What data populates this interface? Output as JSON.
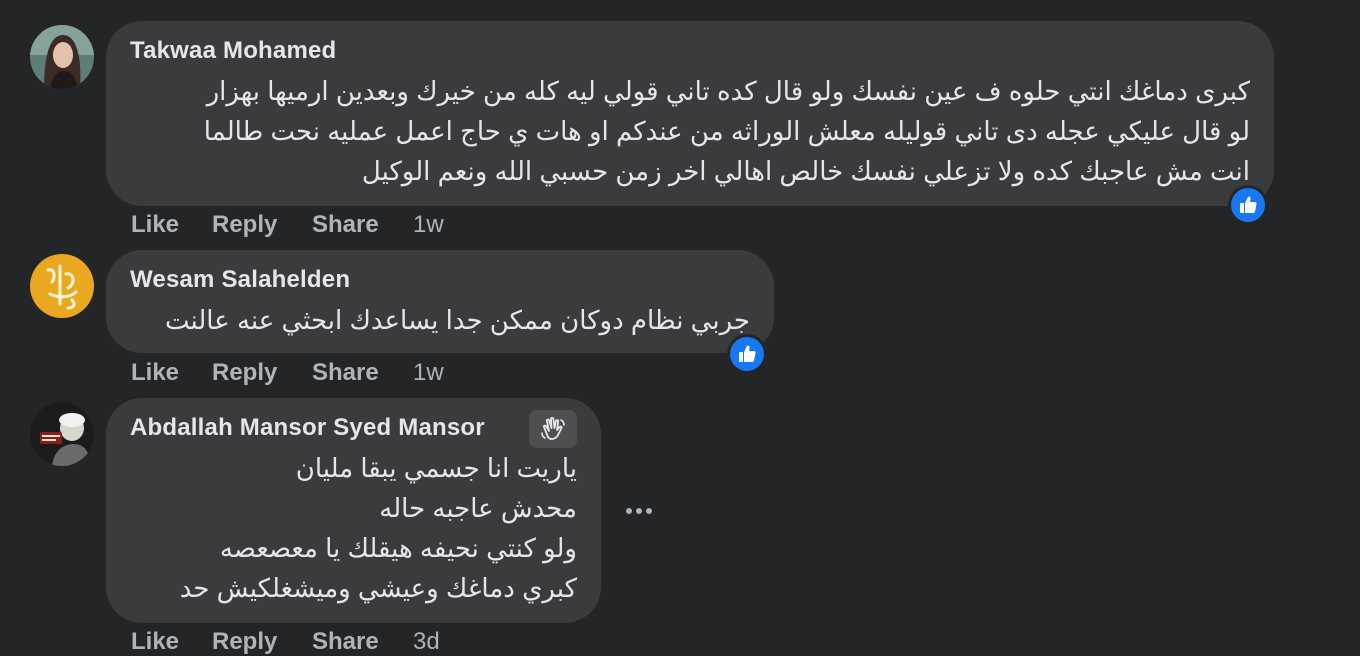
{
  "comments": [
    {
      "author": "Takwaa Mohamed",
      "lines": [
        "كبرى دماغك انتي حلوه ف عين نفسك ولو قال كده تاني قولي ليه كله من خيرك وبعدين ارميها بهزار",
        "لو قال عليكي عجله دى تاني قوليله معلش الوراثه من عندكم او هات ي حاج اعمل عمليه نحت طالما",
        "انت مش عاجبك كده ولا تزعلي نفسك خالص اهالي اخر زمن حسبي الله ونعم الوكيل"
      ],
      "actions": {
        "like": "Like",
        "reply": "Reply",
        "share": "Share",
        "time": "1w"
      },
      "reaction_icon": "like-thumb-icon"
    },
    {
      "author": "Wesam Salahelden",
      "lines": [
        "جربي نظام دوكان ممكن جدا يساعدك ابحثي عنه عالنت"
      ],
      "actions": {
        "like": "Like",
        "reply": "Reply",
        "share": "Share",
        "time": "1w"
      },
      "reaction_icon": "like-thumb-icon"
    },
    {
      "author": "Abdallah Mansor Syed Mansor",
      "lines": [
        "ياريت انا جسمي يبقا مليان",
        "محدش عاجبه حاله",
        "ولو كنتي نحيفه هيقلك يا معصعصه",
        "كبري دماغك وعيشي وميشغلكيش حد"
      ],
      "actions": {
        "like": "Like",
        "reply": "Reply",
        "share": "Share",
        "time": "3d"
      },
      "badge_icon": "waving-hand-icon",
      "more_icon": "more-options-icon"
    }
  ],
  "colors": {
    "background": "#242526",
    "bubble": "#3a3b3c",
    "text": "#e4e6eb",
    "secondary_text": "#b0b3b8",
    "like_blue": "#1877f2"
  }
}
